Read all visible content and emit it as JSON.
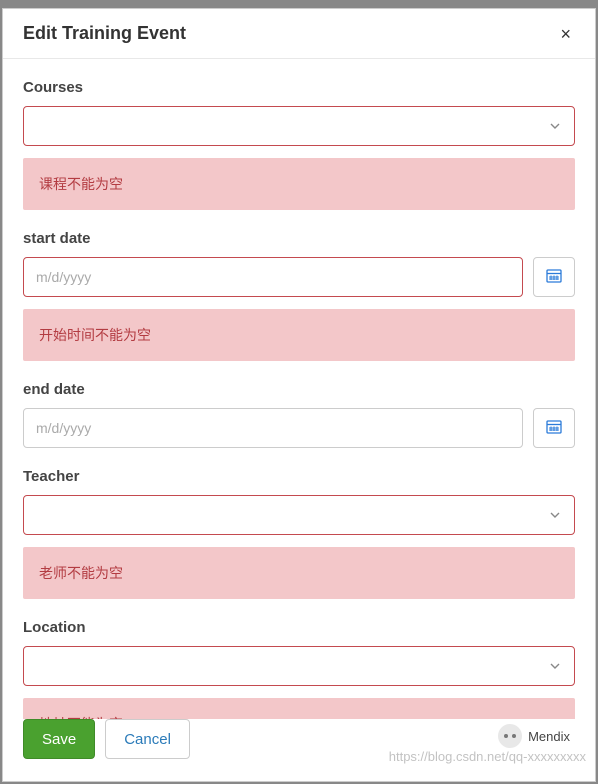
{
  "header": {
    "title": "Edit Training Event",
    "close_label": "×"
  },
  "fields": {
    "courses": {
      "label": "Courses",
      "value": "",
      "error": "课程不能为空"
    },
    "start_date": {
      "label": "start date",
      "placeholder": "m/d/yyyy",
      "value": "",
      "error": "开始时间不能为空"
    },
    "end_date": {
      "label": "end date",
      "placeholder": "m/d/yyyy",
      "value": ""
    },
    "teacher": {
      "label": "Teacher",
      "value": "",
      "error": "老师不能为空"
    },
    "location": {
      "label": "Location",
      "value": "",
      "error": "地址不能为空"
    }
  },
  "footer": {
    "save_label": "Save",
    "cancel_label": "Cancel"
  },
  "brand": {
    "name": "Mendix",
    "watermark": "https://blog.csdn.net/qq-xxxxxxxxx"
  },
  "colors": {
    "error_bg": "#f3c7c9",
    "error_text": "#b33c42",
    "primary": "#4aa12f",
    "link": "#2b7bb9",
    "accent_icon": "#2b7bd9"
  }
}
